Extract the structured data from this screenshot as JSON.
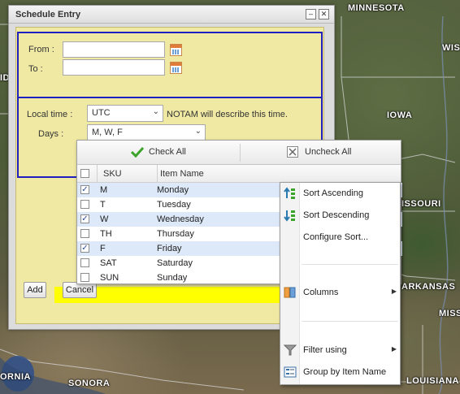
{
  "map": {
    "labels": [
      "MINNESOTA",
      "WIS",
      "IOWA",
      "ID",
      "ISSOURI",
      "ARKANSAS",
      "MISS",
      "ORNIA",
      "SONORA",
      "LOUISIANA"
    ]
  },
  "window": {
    "title": "Schedule Entry",
    "minimize_symbol": "–",
    "close_symbol": "✕"
  },
  "form": {
    "from_label": "From :",
    "from_value": "",
    "to_label": "To :",
    "to_value": "",
    "local_time_label": "Local time :",
    "local_time_value": "UTC",
    "notam_note": "NOTAM will describe this time.",
    "days_label": "Days :",
    "days_value": "M, W, F"
  },
  "buttons": {
    "add": "Add",
    "cancel": "Cancel"
  },
  "picker": {
    "check_all": "Check All",
    "uncheck_all": "Uncheck All",
    "columns": [
      "SKU",
      "Item Name"
    ],
    "rows": [
      {
        "sku": "M",
        "name": "Monday",
        "checked": true,
        "check_mark": "✓"
      },
      {
        "sku": "T",
        "name": "Tuesday",
        "checked": false,
        "check_mark": ""
      },
      {
        "sku": "W",
        "name": "Wednesday",
        "checked": true,
        "check_mark": "✓"
      },
      {
        "sku": "TH",
        "name": "Thursday",
        "checked": false,
        "check_mark": ""
      },
      {
        "sku": "F",
        "name": "Friday",
        "checked": true,
        "check_mark": "✓"
      },
      {
        "sku": "SAT",
        "name": "Saturday",
        "checked": false,
        "check_mark": ""
      },
      {
        "sku": "SUN",
        "name": "Sunday",
        "checked": false,
        "check_mark": ""
      }
    ]
  },
  "context_menu": {
    "sort_ascending": "Sort Ascending",
    "sort_descending": "Sort Descending",
    "configure_sort": "Configure Sort...",
    "columns": "Columns",
    "filter_using": "Filter using",
    "group_by": "Group by Item Name",
    "submenu_arrow": "▶"
  },
  "colors": {
    "form_background": "#f0e9a4",
    "fieldset_border": "#2020c0",
    "highlight_bar": "#ffff00",
    "selected_row": "#dde9f8",
    "check_all_icon": "#3aa32a"
  }
}
